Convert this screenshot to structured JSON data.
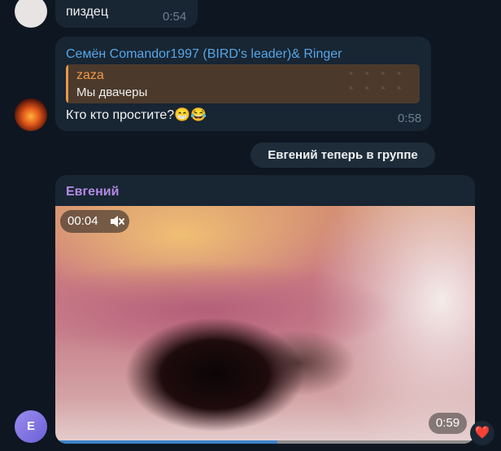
{
  "messages": {
    "top": {
      "text": "пиздец",
      "time": "0:54"
    },
    "semen": {
      "sender": "Семён Comandor1997 (BIRD's leader)& Ringer",
      "reply_name": "zaza",
      "reply_text": "Мы двачеры",
      "text": "Кто кто простите?😁😂",
      "time": "0:58"
    },
    "service": {
      "text": "Евгений теперь в группе"
    },
    "video": {
      "sender": "Евгений",
      "duration": "00:04",
      "time": "0:59",
      "progress_fraction": 0.53,
      "avatar_letter": "E",
      "reaction": "❤️"
    }
  },
  "colors": {
    "background": "#0e1621",
    "bubble": "#182533",
    "sender_blue": "#57a6e6",
    "sender_purple": "#b28ae3",
    "reply_accent": "#f29a46"
  }
}
